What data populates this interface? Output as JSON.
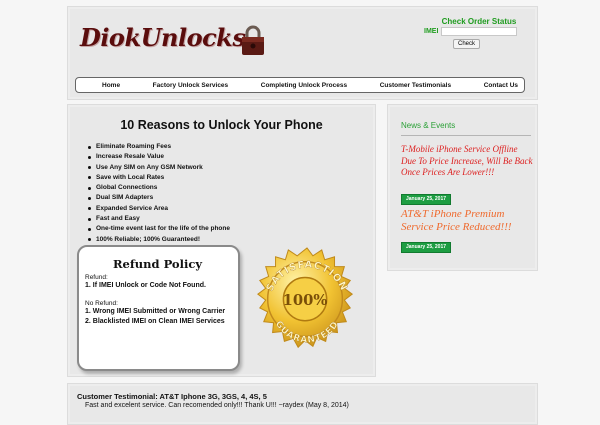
{
  "header": {
    "logo_text": "DiokUnlocks",
    "check_order": {
      "title": "Check Order Status",
      "imei_label": "IMEI",
      "imei_value": "",
      "button_label": "Check"
    },
    "nav": [
      {
        "label": "Home"
      },
      {
        "label": "Factory Unlock Services"
      },
      {
        "label": "Completing Unlock Process"
      },
      {
        "label": "Customer Testimonials"
      },
      {
        "label": "Contact Us"
      }
    ]
  },
  "main": {
    "title": "10 Reasons to Unlock Your Phone",
    "reasons": [
      "Eliminate Roaming Fees",
      "Increase Resale Value",
      "Use Any SIM on Any GSM Network",
      "Save with Local Rates",
      "Global Connections",
      "Dual SIM Adapters",
      "Expanded Service Area",
      "Fast and Easy",
      "One-time event last for the life of the phone",
      "100% Reliable; 100% Guaranteed!"
    ],
    "refund": {
      "title": "Refund Policy",
      "refund_label": "Refund:",
      "refund_items": [
        "1. If IMEI Unlock or Code Not Found."
      ],
      "no_refund_label": "No Refund:",
      "no_refund_items": [
        "1. Wrong IMEI Submitted or Wrong Carrier",
        "2. Blacklisted IMEI on Clean IMEI Services"
      ]
    },
    "seal": {
      "top_text": "SATISFACTION",
      "center_text": "100%",
      "bottom_text": "GUARANTEED"
    }
  },
  "news": {
    "title": "News & Events",
    "items": [
      {
        "text": "T-Mobile iPhone Service Offline Due To Price Increase, Will Be Back Once Prices Are Lower!!!",
        "date": "January 25, 2017",
        "color": "#dd1f1f"
      },
      {
        "text": "AT&T iPhone Premium Service Price Reduced!!!",
        "date": "January 25, 2017",
        "color": "#ef6a2e"
      }
    ]
  },
  "testimonial": {
    "title": "Customer Testimonial: AT&T Iphone 3G, 3GS, 4, 4S, 5",
    "body": "Fast and excelent service. Can recomended only!!! Thank U!!! ~raydex (May 8, 2014)"
  },
  "colors": {
    "accent_green": "#1f9c1f",
    "news_red": "#dd1f1f",
    "news_orange": "#ef6a2e",
    "logo_maroon": "#5a0d0d",
    "seal_gold": "#e8b820"
  },
  "icons": [
    "padlock-icon",
    "satisfaction-seal"
  ]
}
